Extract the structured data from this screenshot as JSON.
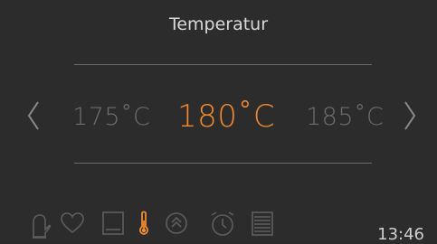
{
  "header": {
    "title": "Temperatur"
  },
  "temperature": {
    "previous": "175˚C",
    "current": "180˚C",
    "next": "185˚C"
  },
  "status": {
    "time": "13:46"
  },
  "toolbar": {
    "icons": [
      "oven-mitt-icon",
      "heart-icon",
      "oven-mode-icon",
      "thermometer-icon",
      "rapid-heat-icon",
      "alarm-clock-icon",
      "recipe-list-icon"
    ]
  },
  "colors": {
    "accent": "#f08a30",
    "background": "#2c2c2c",
    "muted": "#6d6d6d",
    "text": "#d9d9d9"
  }
}
